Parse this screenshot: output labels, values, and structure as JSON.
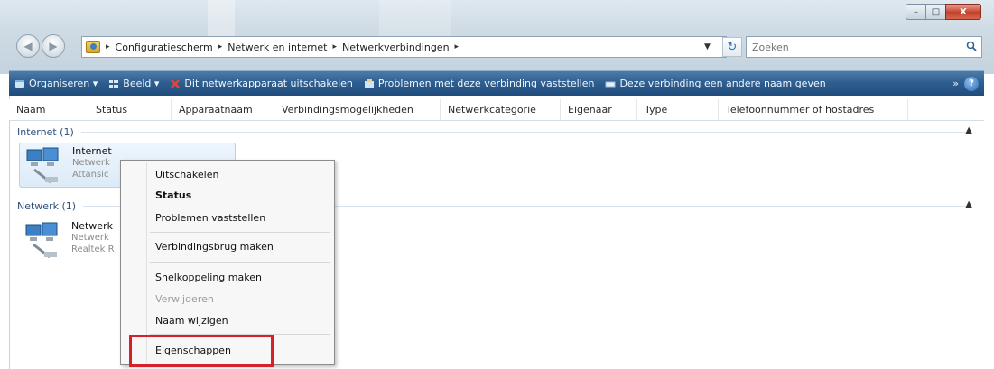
{
  "window": {
    "controls": {
      "minimize": "–",
      "maximize": "□",
      "close": "X"
    }
  },
  "address": {
    "breadcrumbs": [
      "Configuratiescherm",
      "Netwerk en internet",
      "Netwerkverbindingen"
    ],
    "separator": "▸"
  },
  "search": {
    "placeholder": "Zoeken"
  },
  "toolbar": {
    "items": [
      {
        "label": "Organiseren ▾",
        "icon": "organize-icon"
      },
      {
        "label": "Beeld ▾",
        "icon": "view-icon"
      },
      {
        "label": "Dit netwerkapparaat uitschakelen",
        "icon": "disable-icon"
      },
      {
        "label": "Problemen met deze verbinding vaststellen",
        "icon": "diagnose-icon"
      },
      {
        "label": "Deze verbinding een andere naam geven",
        "icon": "rename-icon"
      }
    ],
    "more": "»",
    "help": "?"
  },
  "columns": [
    "Naam",
    "Status",
    "Apparaatnaam",
    "Verbindingsmogelijkheden",
    "Netwerkcategorie",
    "Eigenaar",
    "Type",
    "Telefoonnummer of hostadres"
  ],
  "groups": [
    {
      "header": "Internet (1)",
      "item": {
        "name": "Internet",
        "line2": "Netwerk",
        "line3": "Attansic"
      }
    },
    {
      "header": "Netwerk (1)",
      "item": {
        "name": "Netwerk",
        "line2": "Netwerk",
        "line3": "Realtek R"
      }
    }
  ],
  "context_menu": {
    "items": [
      {
        "label": "Uitschakelen",
        "style": "normal"
      },
      {
        "label": "Status",
        "style": "bold"
      },
      {
        "label": "Problemen vaststellen",
        "style": "normal"
      },
      {
        "label": "Verbindingsbrug maken",
        "style": "normal"
      },
      {
        "label": "Snelkoppeling maken",
        "style": "normal"
      },
      {
        "label": "Verwijderen",
        "style": "disabled"
      },
      {
        "label": "Naam wijzigen",
        "style": "normal"
      },
      {
        "label": "Eigenschappen",
        "style": "highlighted"
      }
    ]
  },
  "colors": {
    "toolbar": "#2f5f91",
    "highlight": "#d8202b",
    "group_text": "#2d4f7c"
  }
}
